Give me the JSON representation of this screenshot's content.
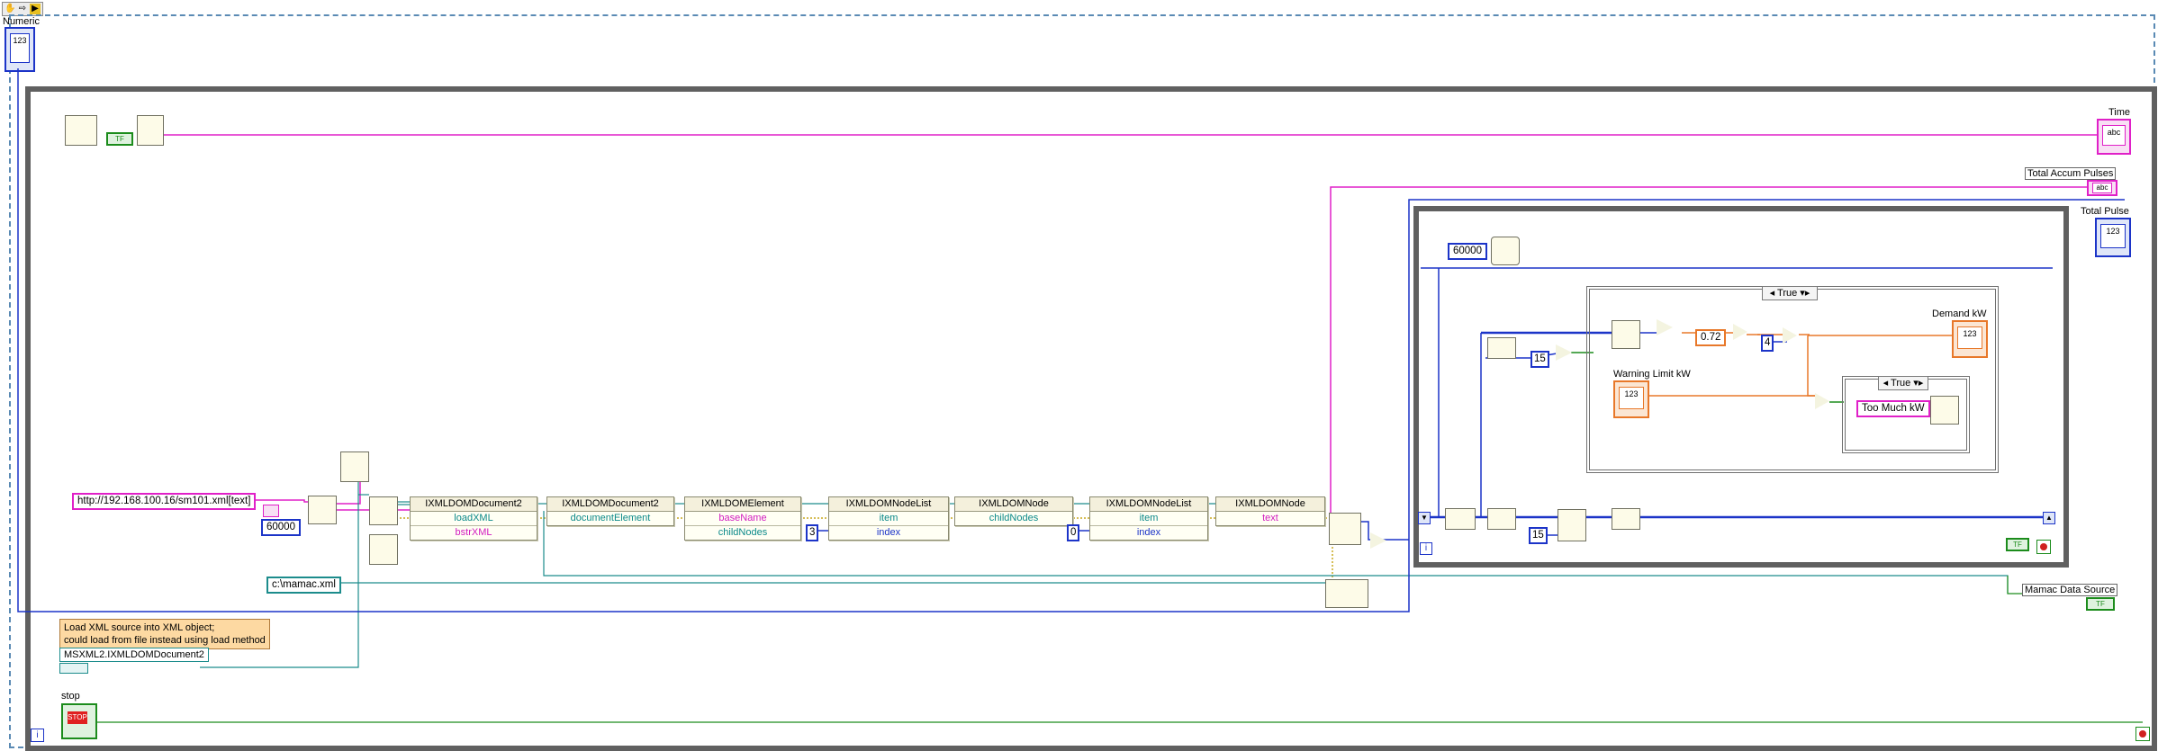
{
  "toolbar": {
    "items": [
      "hand-icon",
      "arrow-icon",
      "run-icon"
    ]
  },
  "labels": {
    "numeric": "Numeric",
    "time": "Time",
    "total_accum_pulses": "Total Accum Pulses",
    "total_pulse": "Total Pulse",
    "demand_kw": "Demand kW",
    "warning_limit_kw": "Warning Limit kW",
    "mamac_data_source": "Mamac Data Source",
    "stop": "stop"
  },
  "constants": {
    "url": "http://192.168.100.16/sm101.xml[text]",
    "timeout": "60000",
    "file_path": "c:\\mamac.xml",
    "class_name": "MSXML2.IXMLDOMDocument2",
    "wait_ms": "60000",
    "fifteen_a": "15",
    "fifteen_b": "15",
    "factor": "0.72",
    "four": "4",
    "index_three": "3",
    "index_zero": "0",
    "too_much": "Too Much kW"
  },
  "note": {
    "line1": "Load XML source into XML object;",
    "line2": "could load from file instead using load method"
  },
  "case_selectors": {
    "outer": "True",
    "inner": "True"
  },
  "nodes": [
    {
      "title": "IXMLDOMDocument2",
      "rows": [
        {
          "text": "loadXML",
          "color": "teal"
        },
        {
          "text": "bstrXML",
          "color": "pink"
        }
      ]
    },
    {
      "title": "IXMLDOMDocument2",
      "rows": [
        {
          "text": "documentElement",
          "color": "teal"
        }
      ]
    },
    {
      "title": "IXMLDOMElement",
      "rows": [
        {
          "text": "baseName",
          "color": "pink"
        },
        {
          "text": "childNodes",
          "color": "teal"
        }
      ]
    },
    {
      "title": "IXMLDOMNodeList",
      "rows": [
        {
          "text": "item",
          "color": "teal"
        },
        {
          "text": "index",
          "color": "blue"
        }
      ]
    },
    {
      "title": "IXMLDOMNode",
      "rows": [
        {
          "text": "childNodes",
          "color": "teal"
        }
      ]
    },
    {
      "title": "IXMLDOMNodeList",
      "rows": [
        {
          "text": "item",
          "color": "teal"
        },
        {
          "text": "index",
          "color": "blue"
        }
      ]
    },
    {
      "title": "IXMLDOMNode",
      "rows": [
        {
          "text": "text",
          "color": "pink"
        }
      ]
    }
  ],
  "indicators": {
    "num_123": "123",
    "abc": "abc",
    "stop_text": "STOP",
    "tf": "TF",
    "info": "i"
  },
  "colors": {
    "wire_pink": "#e020c8",
    "wire_blue": "#1c34c8",
    "wire_orange": "#e8782a",
    "wire_teal": "#1c8c8c",
    "wire_green": "#1c8c1c",
    "frame_gray": "#606060",
    "outer_dash": "#5a8ab4"
  }
}
